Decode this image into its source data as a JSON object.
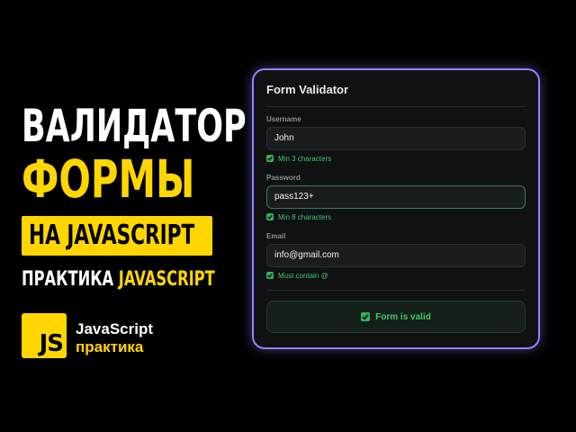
{
  "promo": {
    "headline_line1": "ВАЛИДАТОР",
    "headline_line2": "ФОРМЫ",
    "headline_line3": "НА JAVASCRIPT",
    "subline_prefix": "ПРАКТИКА ",
    "subline_accent": "JAVASCRIPT",
    "logo_text": "JS",
    "brand_name": "JavaScript",
    "brand_sub": "практика"
  },
  "form": {
    "title": "Form Validator",
    "fields": {
      "username": {
        "label": "Username",
        "value": "John",
        "hint": "Min 3 characters"
      },
      "password": {
        "label": "Password",
        "value": "pass123+",
        "hint": "Min 8 characters"
      },
      "email": {
        "label": "Email",
        "value": "info@gmail.com",
        "hint": "Must contain @"
      }
    },
    "status": "Form is valid"
  },
  "colors": {
    "accent_yellow": "#ffd600",
    "card_border": "#8f86ff",
    "valid_green": "#44c46a",
    "background": "#000000"
  },
  "icons": {
    "check": "check-icon",
    "js_logo": "js-logo"
  }
}
